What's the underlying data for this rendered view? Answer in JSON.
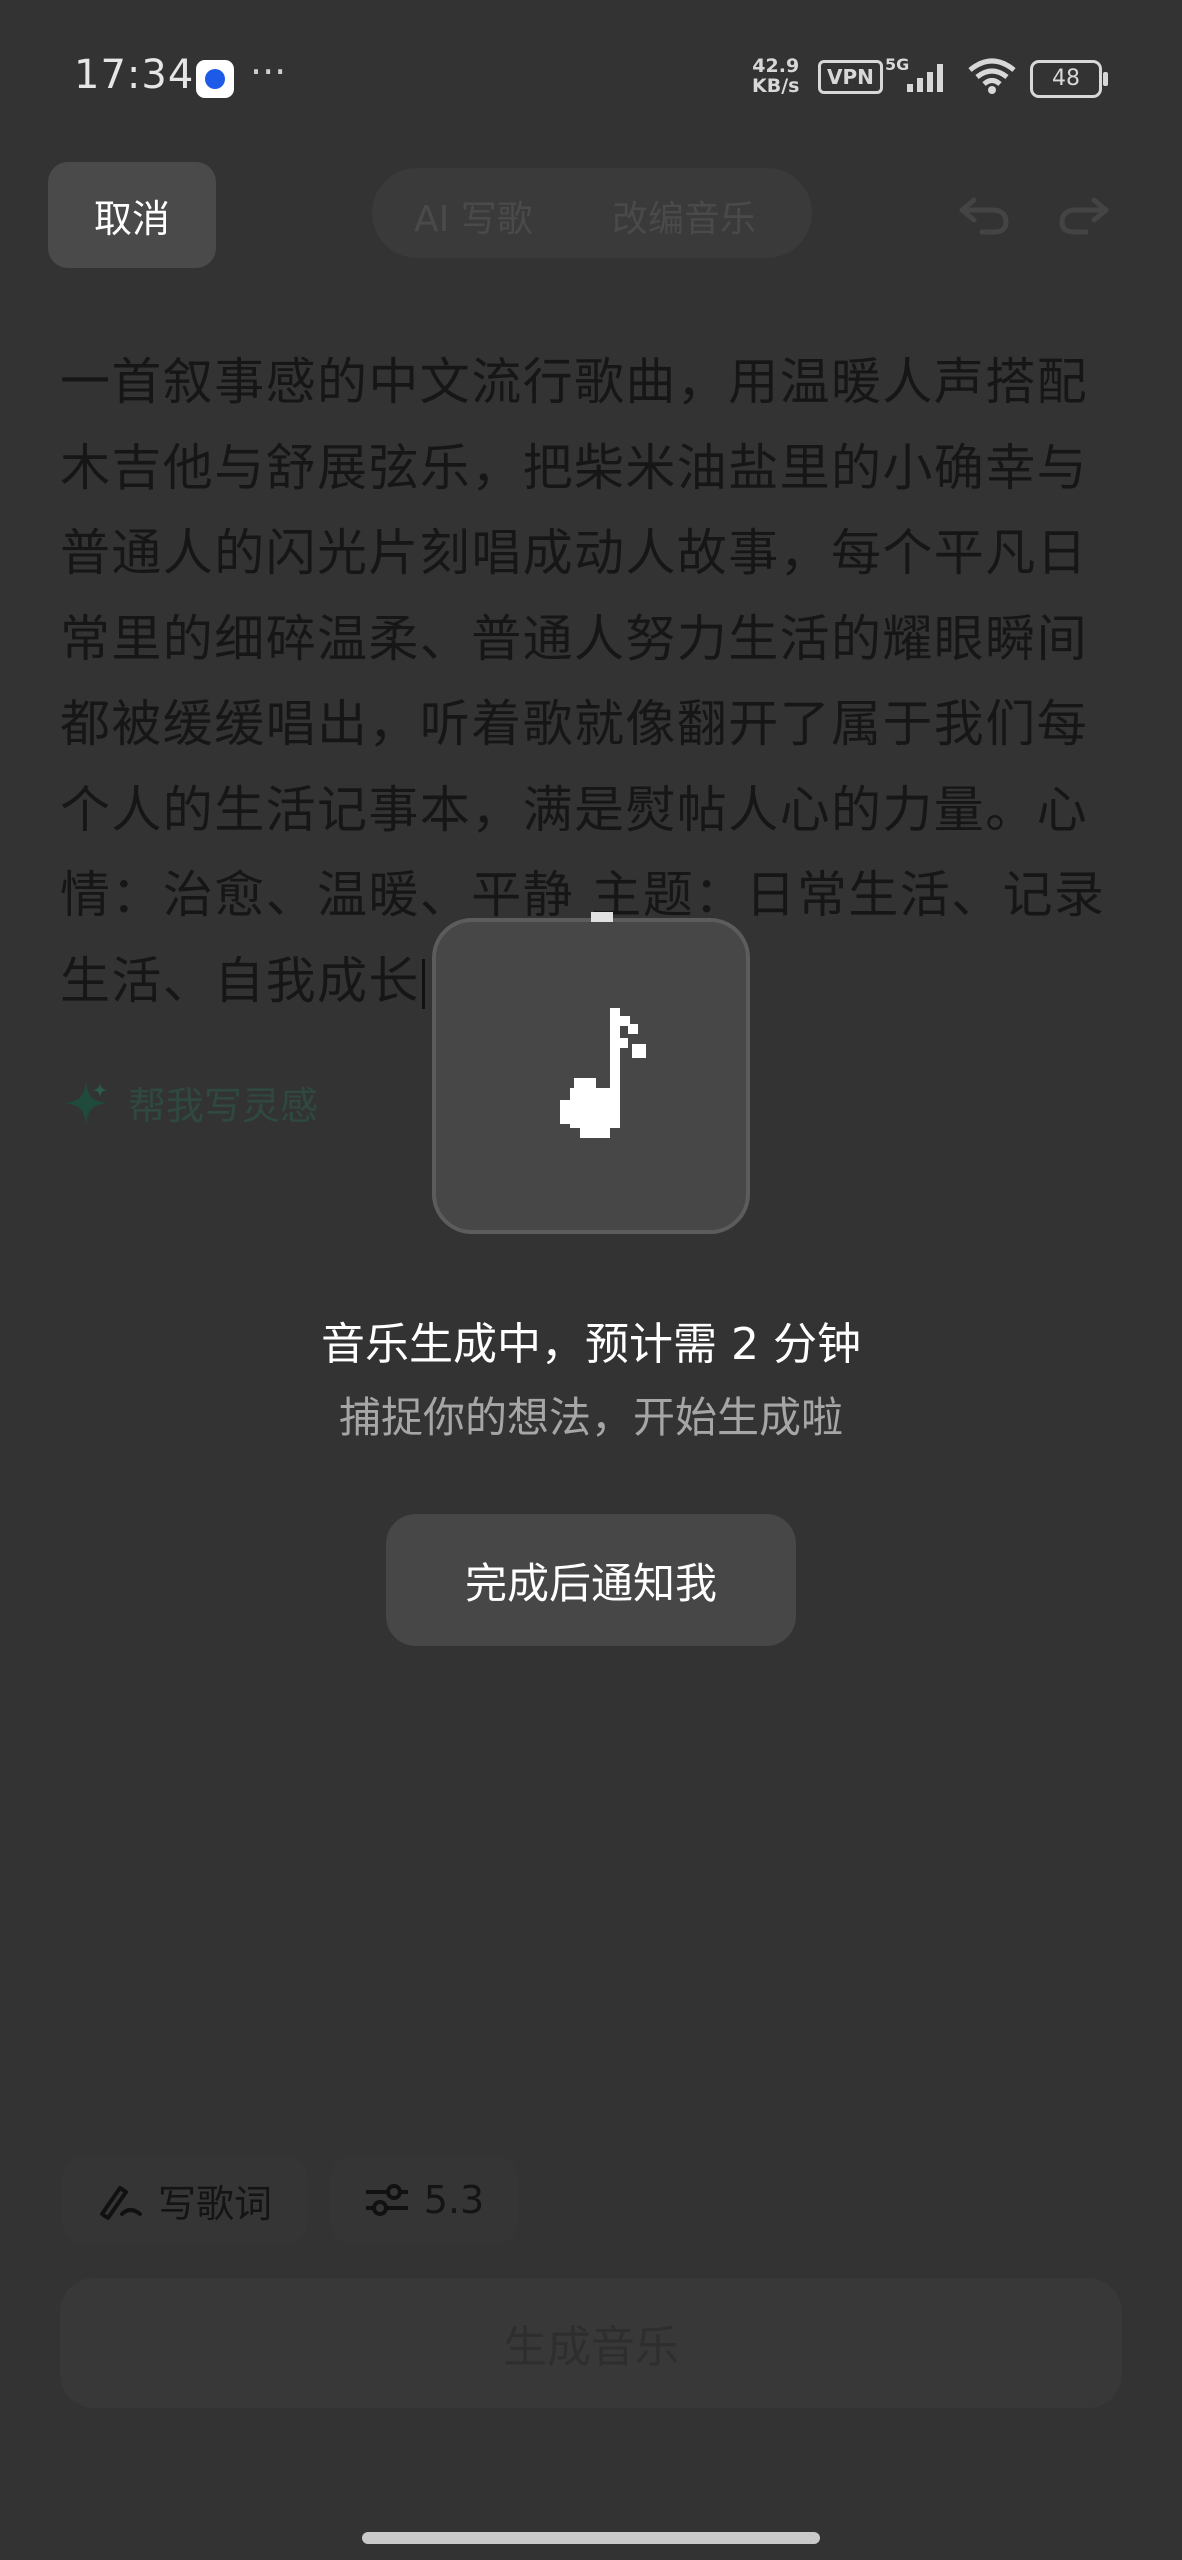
{
  "status_bar": {
    "time": "17:34",
    "more": "···",
    "speed_value": "42.9",
    "speed_unit": "KB/s",
    "vpn": "VPN",
    "network": "5G",
    "battery": "48"
  },
  "header": {
    "cancel_label": "取消",
    "tabs": [
      {
        "label": "AI 写歌"
      },
      {
        "label": "改编音乐"
      }
    ]
  },
  "prompt": {
    "text": "一首叙事感的中文流行歌曲，用温暖人声搭配木吉他与舒展弦乐，把柴米油盐里的小确幸与普通人的闪光片刻唱成动人故事，每个平凡日常里的细碎温柔、普通人努力生活的耀眼瞬间都被缓缓唱出，听着歌就像翻开了属于我们每个人的生活记事本，满是熨帖人心的力量。心情：治愈、温暖、平静 主题：日常生活、记录生活、自我成长"
  },
  "inspire_label": "帮我写灵感",
  "generating": {
    "title": "音乐生成中，预计需 2 分钟",
    "subtitle": "捕捉你的想法，开始生成啦",
    "notify_label": "完成后通知我"
  },
  "bottom": {
    "lyrics_label": "写歌词",
    "version_label": "5.3",
    "generate_label": "生成音乐"
  }
}
